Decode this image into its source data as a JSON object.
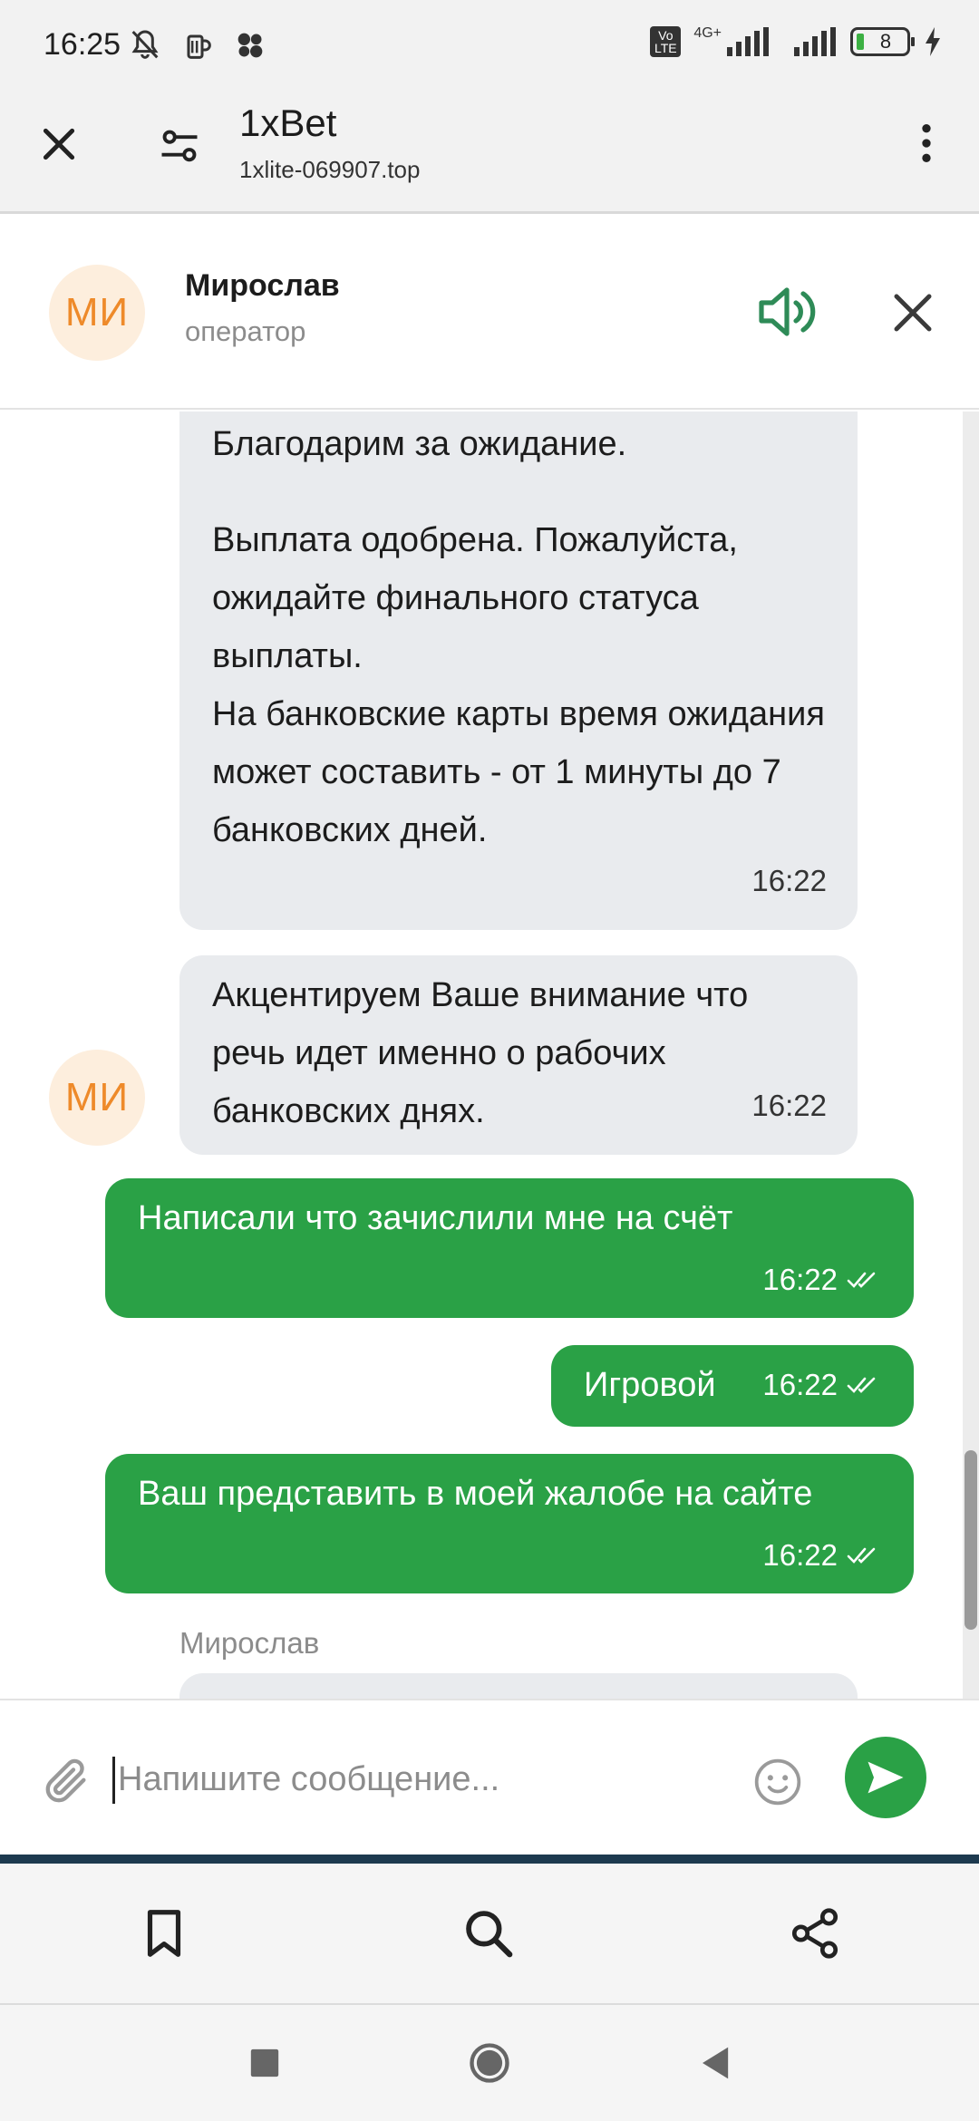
{
  "status_bar": {
    "time": "16:25",
    "network": "4G+",
    "volte": "Vo LTE",
    "battery": "8"
  },
  "browser": {
    "title": "1xBet",
    "url": "1xlite-069907.top"
  },
  "chat_header": {
    "avatar_initials": "МИ",
    "operator_name": "Мирослав",
    "operator_role": "оператор"
  },
  "messages": [
    {
      "direction": "in",
      "paragraph1": "Благодарим за ожидание.",
      "paragraph2": "Выплата одобрена. Пожалуйста, ожидайте финального статуса выплаты.\nНа банковские карты время ожидания может составить - от 1 минуты до 7 банковских дней.",
      "time": "16:22"
    },
    {
      "direction": "in",
      "text": "Акцентируем Ваше внимание что речь идет именно о рабочих банковских днях.",
      "time": "16:22",
      "avatar_initials": "МИ"
    },
    {
      "direction": "out",
      "text": "Написали что зачислили мне на счёт",
      "time": "16:22",
      "status": "read"
    },
    {
      "direction": "out",
      "text": "Игровой",
      "time": "16:22",
      "status": "read"
    },
    {
      "direction": "out",
      "text": "Ваш представить в моей жалобе на сайте",
      "time": "16:22",
      "status": "read"
    },
    {
      "direction": "in",
      "sender": "Мирослав"
    }
  ],
  "composer": {
    "placeholder": "Напишите сообщение...",
    "value": ""
  },
  "colors": {
    "outgoing_bubble": "#2aa146",
    "incoming_bubble": "#e9ebee",
    "avatar_bg": "#fdeedd",
    "avatar_text": "#ee8a2a",
    "accent_green": "#2aa146"
  },
  "icons": {
    "browser": [
      "close-icon",
      "tune-icon",
      "more-vert-icon"
    ],
    "chat": [
      "volume-icon",
      "close-icon",
      "attach-icon",
      "emoji-icon",
      "send-icon",
      "double-check-icon"
    ],
    "toolbar": [
      "bookmark-icon",
      "search-icon",
      "share-icon"
    ],
    "nav": [
      "recents-icon",
      "home-icon",
      "back-icon"
    ]
  }
}
